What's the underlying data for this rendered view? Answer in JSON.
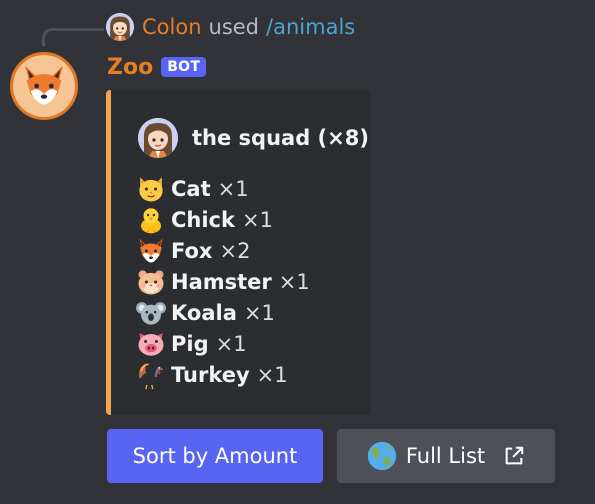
{
  "reply": {
    "user": "Colon",
    "verb": "used",
    "command": "/animals",
    "avatar_icon": "girl-avatar-icon"
  },
  "message": {
    "author": "Zoo",
    "bot_tag": "BOT",
    "avatar_icon": "fox-avatar-icon"
  },
  "embed": {
    "accent_color": "#f0a44c",
    "author_name": "the squad (×8)",
    "author_icon": "girl-avatar-icon",
    "animals": [
      {
        "icon": "cat-icon",
        "name": "Cat",
        "count": "×1"
      },
      {
        "icon": "chick-icon",
        "name": "Chick",
        "count": "×1"
      },
      {
        "icon": "fox-icon",
        "name": "Fox",
        "count": "×2"
      },
      {
        "icon": "hamster-icon",
        "name": "Hamster",
        "count": "×1"
      },
      {
        "icon": "koala-icon",
        "name": "Koala",
        "count": "×1"
      },
      {
        "icon": "pig-icon",
        "name": "Pig",
        "count": "×1"
      },
      {
        "icon": "turkey-icon",
        "name": "Turkey",
        "count": "×1"
      }
    ]
  },
  "buttons": {
    "sort_label": "Sort by Amount",
    "full_list_label": "Full List",
    "full_list_icon": "globe-icon",
    "external_icon": "external-link-icon"
  },
  "colors": {
    "background": "#313338",
    "embed_background": "#2b2d31",
    "username": "#e67e22",
    "command_link": "#4ba6cf",
    "primary_button": "#5865f2",
    "secondary_button": "#4e5058"
  }
}
